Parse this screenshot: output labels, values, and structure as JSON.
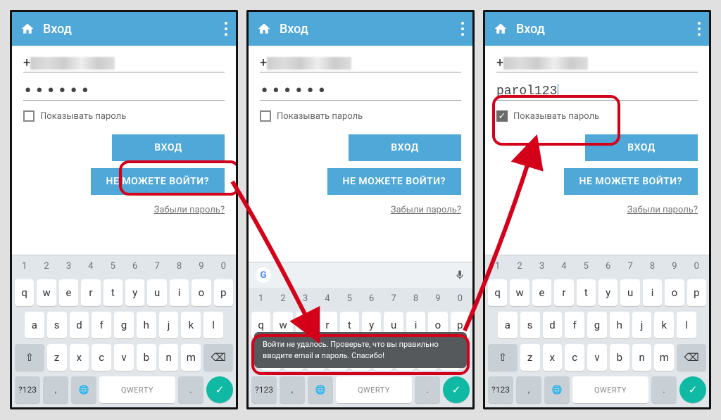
{
  "appbar": {
    "title": "Вход"
  },
  "form": {
    "phone_prefix": "+",
    "password_masked": "••••••",
    "password_plain": "parol123",
    "show_pw_label": "Показывать пароль",
    "login_btn": "ВХОД",
    "cant_login_btn": "НЕ МОЖЕТЕ ВОЙТИ?",
    "forgot_link": "Забыли пароль?"
  },
  "toast": {
    "text": "Войти не удалось. Проверьте, что вы правильно вводите email и пароль. Спасибо!"
  },
  "keyboard": {
    "nums": [
      "1",
      "2",
      "3",
      "4",
      "5",
      "6",
      "7",
      "8",
      "9",
      "0"
    ],
    "row1": [
      "q",
      "w",
      "e",
      "r",
      "t",
      "y",
      "u",
      "i",
      "o",
      "p"
    ],
    "row2": [
      "a",
      "s",
      "d",
      "f",
      "g",
      "h",
      "j",
      "k",
      "l"
    ],
    "row3": [
      "z",
      "x",
      "c",
      "v",
      "b",
      "n",
      "m"
    ],
    "shift": "⇧",
    "backspace": "⌫",
    "sym": "?123",
    "comma": ",",
    "globe": "🌐",
    "space": "QWERTY",
    "period": ".",
    "enter": "✓"
  }
}
